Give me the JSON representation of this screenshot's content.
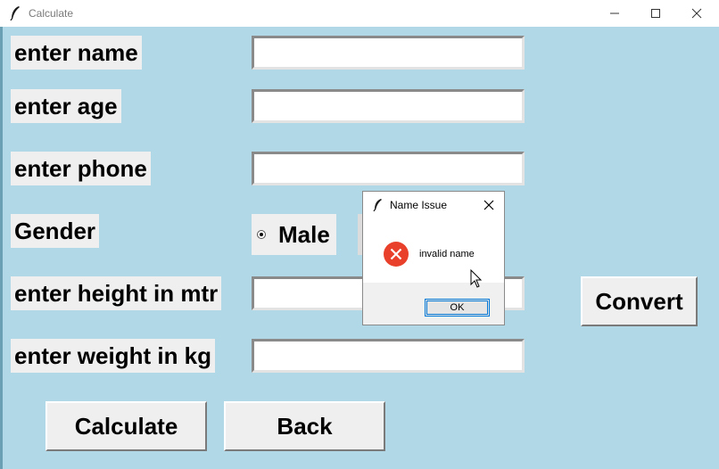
{
  "window": {
    "title": "Calculate",
    "icon": "feather-icon",
    "controls": [
      "minimize-icon",
      "maximize-icon",
      "close-icon"
    ]
  },
  "form": {
    "name_label": "enter name",
    "name_value": "",
    "age_label": "enter age",
    "age_value": "",
    "phone_label": "enter phone",
    "phone_value": "",
    "gender_label": "Gender",
    "gender_option_male": "Male",
    "gender_selected": "Male",
    "height_label": "enter height in mtr",
    "height_value": "",
    "weight_label": "enter weight in kg",
    "weight_value": ""
  },
  "buttons": {
    "convert": "Convert",
    "calculate": "Calculate",
    "back": "Back"
  },
  "dialog": {
    "title": "Name Issue",
    "icon": "feather-icon",
    "status_icon": "error-icon",
    "message": "invalid name",
    "ok_label": "OK"
  },
  "colors": {
    "background": "#b0d8e6",
    "label_bg": "#f0eff0",
    "error_red": "#e8402a",
    "focus_blue": "#0078d7"
  }
}
